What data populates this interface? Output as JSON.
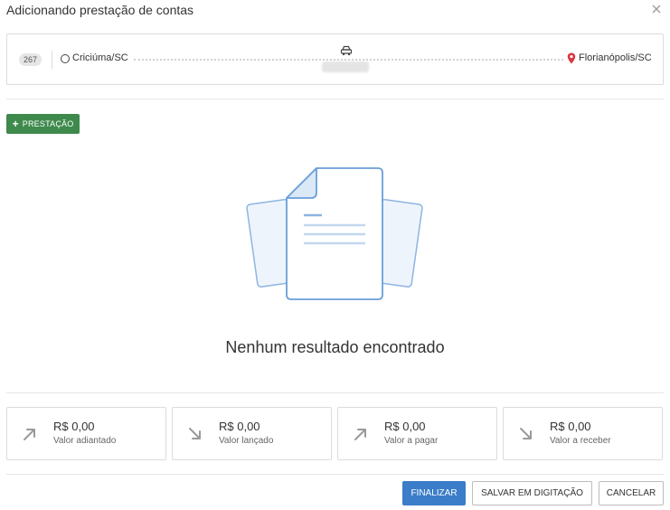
{
  "modal": {
    "title": "Adicionando prestação de contas"
  },
  "route": {
    "trip_number": "267",
    "origin": "Criciúma/SC",
    "destination": "Florianópolis/SC"
  },
  "actions": {
    "add_label": "PRESTAÇÃO"
  },
  "empty_state": {
    "message": "Nenhum resultado encontrado"
  },
  "summary": [
    {
      "amount": "R$ 0,00",
      "caption": "Valor adiantado",
      "icon": "arrow-up-right-icon"
    },
    {
      "amount": "R$ 0,00",
      "caption": "Valor lançado",
      "icon": "arrow-down-right-icon"
    },
    {
      "amount": "R$ 0,00",
      "caption": "Valor a pagar",
      "icon": "arrow-up-right-icon"
    },
    {
      "amount": "R$ 0,00",
      "caption": "Valor a receber",
      "icon": "arrow-down-right-icon"
    }
  ],
  "footer": {
    "finalize_label": "FINALIZAR",
    "save_draft_label": "SALVAR EM DIGITAÇÃO",
    "cancel_label": "CANCELAR"
  },
  "colors": {
    "primary": "#3b7dc8",
    "success": "#3e8a4d",
    "pin": "#d9363e",
    "illustration": "#6a9fd8"
  }
}
